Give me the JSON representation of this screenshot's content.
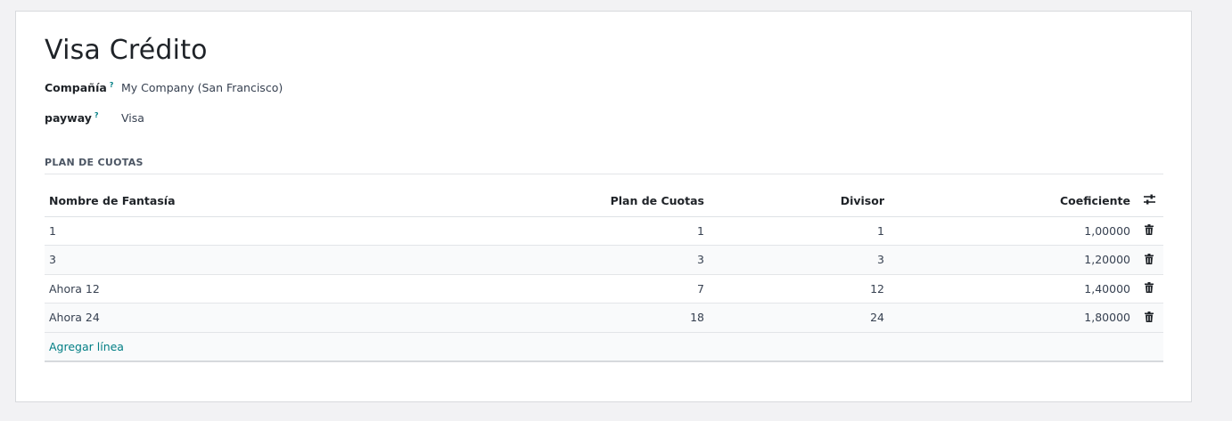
{
  "record": {
    "title": "Visa Crédito"
  },
  "fields": {
    "company_label": "Compañía",
    "company_help": "?",
    "company_value": "My Company (San Francisco)",
    "payway_label": "payway",
    "payway_help": "?",
    "payway_value": "Visa"
  },
  "section": {
    "title": "PLAN DE CUOTAS"
  },
  "table": {
    "headers": {
      "name": "Nombre de Fantasía",
      "plan": "Plan de Cuotas",
      "divisor": "Divisor",
      "coef": "Coeficiente"
    },
    "rows": [
      {
        "name": "1",
        "plan": "1",
        "divisor": "1",
        "coef": "1,00000"
      },
      {
        "name": "3",
        "plan": "3",
        "divisor": "3",
        "coef": "1,20000"
      },
      {
        "name": "Ahora 12",
        "plan": "7",
        "divisor": "12",
        "coef": "1,40000"
      },
      {
        "name": "Ahora 24",
        "plan": "18",
        "divisor": "24",
        "coef": "1,80000"
      }
    ],
    "add_line_label": "Agregar línea",
    "column_settings_icon": "sliders-icon",
    "row_delete_icon": "trash-icon"
  },
  "colors": {
    "accent": "#017e84",
    "text": "#374151",
    "heading": "#1f2328"
  }
}
